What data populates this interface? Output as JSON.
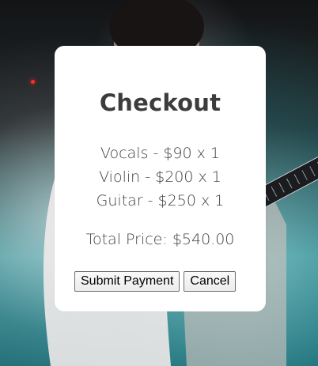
{
  "checkout": {
    "title": "Checkout",
    "items": [
      "Vocals - $90 x 1",
      "Violin - $200 x 1",
      "Guitar - $250 x 1"
    ],
    "total": "Total Price: $540.00",
    "submit_label": "Submit Payment",
    "cancel_label": "Cancel"
  },
  "colors": {
    "modal_background": "#ffffff",
    "text": "#414141",
    "title": "#3c3c3c",
    "background_dark": "#0c1012",
    "background_teal": "#3f9399",
    "stage_light": "#ff2d24"
  }
}
